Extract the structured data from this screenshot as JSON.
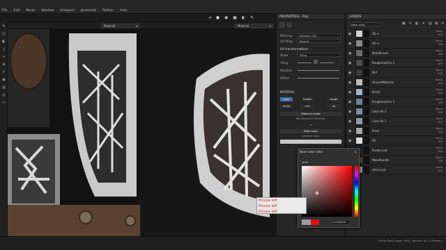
{
  "menu": [
    "File",
    "Edit",
    "Mode",
    "Window",
    "Viewport",
    "Javascript",
    "Python",
    "Help"
  ],
  "view2d": {
    "mode": "Material"
  },
  "view3d": {
    "mode": "Material"
  },
  "properties": {
    "title": "PROPERTIES - FILL",
    "filtering_label": "Filtering",
    "filtering_value": "Bilinear | HQ",
    "uvwrap_label": "UV Wrap",
    "uvwrap_value": "Repeat",
    "uv_section": "UV transformations",
    "scale_label": "Scale",
    "scale_value": "Tiling",
    "tiling_label": "Tiling",
    "rotation_label": "Rotation",
    "offset_label": "Offset",
    "material_section": "MATERIAL",
    "channels": [
      "color",
      "height",
      "rough",
      "metal",
      "nrm",
      "ao"
    ],
    "material_mode": "Material mode",
    "no_resource": "No Resource Selected",
    "or": "or",
    "base_color": "Base color",
    "uniform_color": "uniform color"
  },
  "layers": {
    "title": "LAYERS",
    "channel": "Base color",
    "items": [
      {
        "name": "AO +",
        "blend": "Norm",
        "opacity": "100",
        "thumb": "#cfcfcf"
      },
      {
        "name": "AO +",
        "blend": "Norm",
        "opacity": "100",
        "thumb": "#8a8a8a"
      },
      {
        "name": "Metalbrand",
        "blend": "Norm",
        "opacity": "100",
        "thumb": "#6b6b6b"
      },
      {
        "name": "Roughmask1a 2",
        "blend": "Norm",
        "opacity": "100",
        "thumb": "#4e4e4e"
      },
      {
        "name": "Dirt",
        "blend": "Norm",
        "opacity": "100",
        "thumb": "#3b3b3b"
      },
      {
        "name": "GroundMaterial",
        "blend": "Norm",
        "opacity": "100",
        "thumb": "#bdbdbd"
      },
      {
        "name": "Brush",
        "blend": "Norm",
        "opacity": "100",
        "thumb": "#9fb3c8"
      },
      {
        "name": "Roughmask1a 1",
        "blend": "Norm",
        "opacity": "100",
        "thumb": "#6f7f90"
      },
      {
        "name": "Color fix 2",
        "blend": "Norm",
        "opacity": "100",
        "thumb": "#7d8c99"
      },
      {
        "name": "Color fix 1",
        "blend": "Norm",
        "opacity": "100",
        "thumb": "#8e9aa5"
      },
      {
        "name": "Fleck",
        "blend": "Norm",
        "opacity": "100",
        "thumb": "#a7a7a7"
      },
      {
        "name": "Fill",
        "blend": "Norm",
        "opacity": "100",
        "thumb": "#dcdcdc"
      },
      {
        "name": "Fixate.cust",
        "blend": "Norm",
        "opacity": "100",
        "thumb": "#2a2a2a"
      },
      {
        "name": "Woodhandle",
        "blend": "Norm",
        "opacity": "100",
        "thumb": "#5a4030"
      },
      {
        "name": "steel.cust",
        "blend": "Norm",
        "opacity": "100",
        "thumb": "#999"
      }
    ]
  },
  "colorpicker": {
    "title": "Base color color",
    "hex": "#f00",
    "value": "0.243453",
    "hue_color": "#ff0000"
  },
  "tooltip": [
    "Mouse left",
    "Mouse left",
    "Mouse left"
  ],
  "status": "Cache Disk Usage: 99% | Version: 6.1.2 (Steam)"
}
